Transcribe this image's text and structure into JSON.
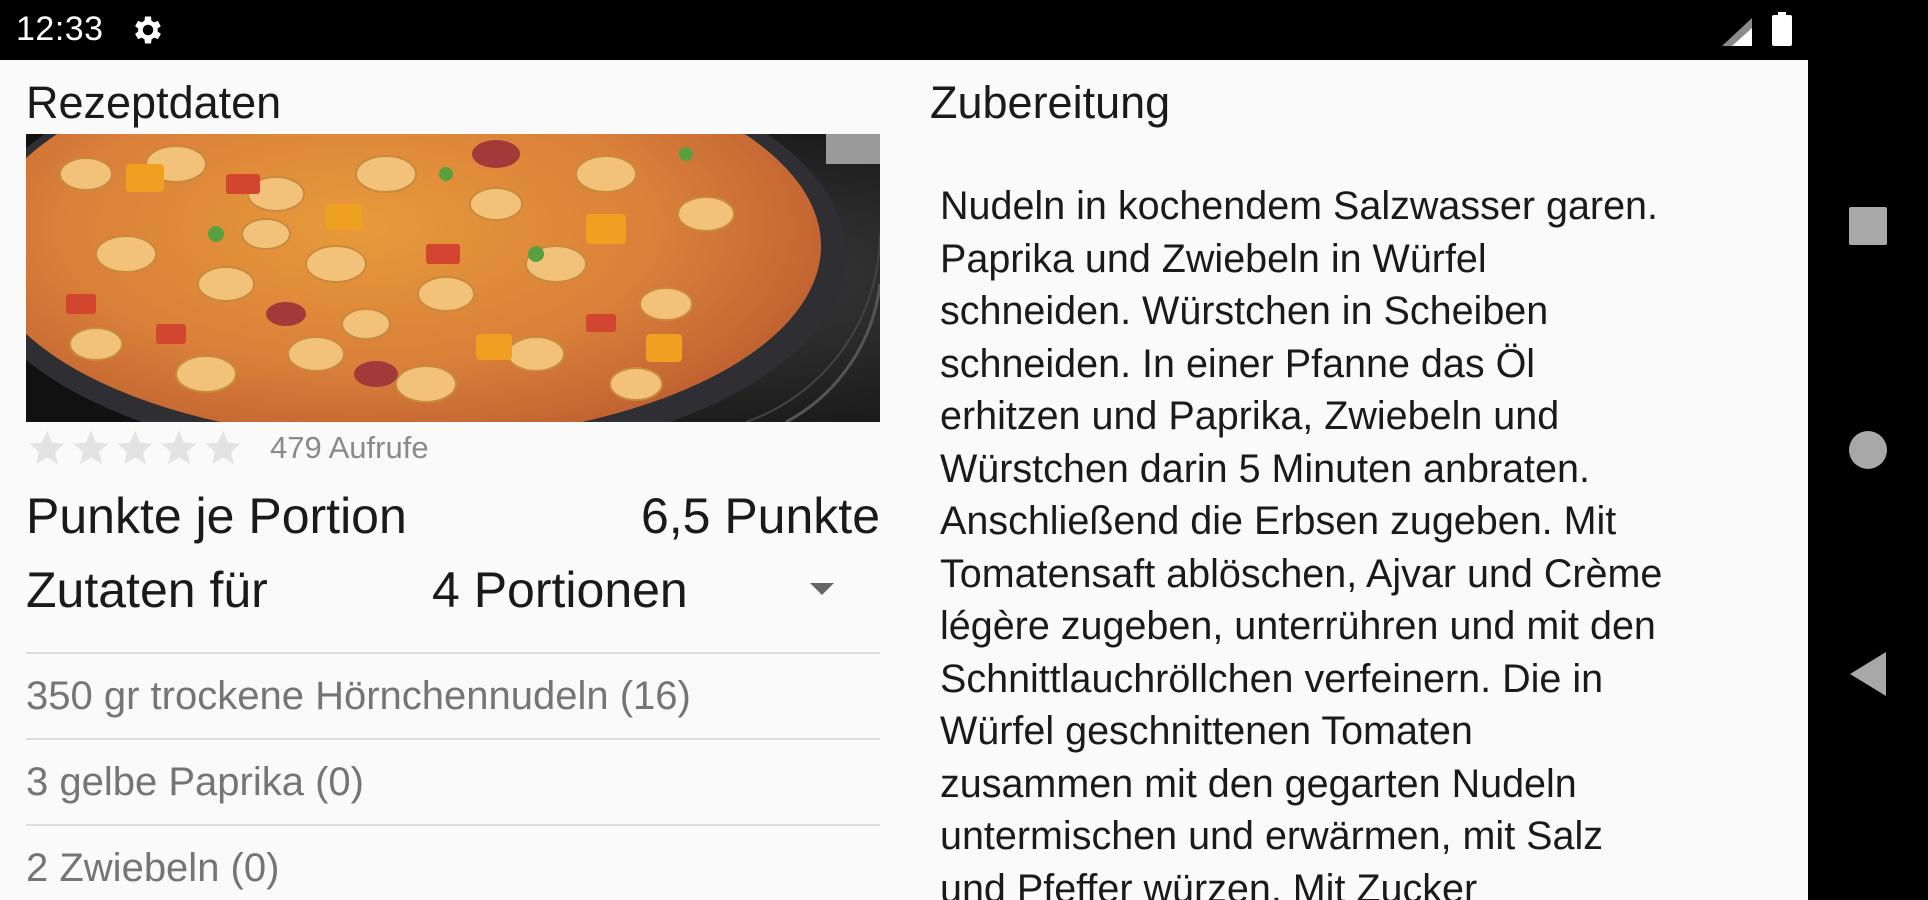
{
  "status_bar": {
    "time": "12:33",
    "icons": [
      "gear-icon",
      "signal-icon",
      "battery-icon"
    ]
  },
  "recipe_data": {
    "title": "Rezeptdaten",
    "image_alt": "Hörnchennudeln mit Paprika und Würstchen in der Pfanne",
    "rating": {
      "stars_filled": 0,
      "stars_total": 5
    },
    "views": "479 Aufrufe",
    "points_label": "Punkte je Portion",
    "points_value": "6,5 Punkte",
    "servings_label": "Zutaten für",
    "servings_value": "4 Portionen",
    "ingredients": [
      "350 gr trockene Hörnchennudeln (16)",
      "3 gelbe Paprika  (0)",
      "2 Zwiebeln  (0)"
    ]
  },
  "preparation": {
    "title": "Zubereitung",
    "text": "Nudeln in kochendem Salzwasser garen.\nPaprika und Zwiebeln in Würfel\nschneiden. Würstchen in Scheiben\nschneiden. In einer Pfanne das Öl\nerhitzen und Paprika, Zwiebeln und\nWürstchen darin 5 Minuten anbraten.\nAnschließend die Erbsen zugeben. Mit\nTomatensaft ablöschen, Ajvar und Crème\nlégère zugeben, unterrühren und mit den\nSchnittlauchröllchen verfeinern. Die in\nWürfel geschnittenen Tomaten\nzusammen mit den gegarten Nudeln\nuntermischen und erwärmen, mit Salz\nund Pfeffer würzen. Mit Zucker"
  },
  "nav_bar": {
    "buttons": [
      "recents-button",
      "home-button",
      "back-button"
    ]
  },
  "colors": {
    "background": "#fafafa",
    "text_primary": "#1a1a1a",
    "text_secondary": "#757575",
    "divider": "#dddddd",
    "star_empty": "#e3e3e3"
  }
}
